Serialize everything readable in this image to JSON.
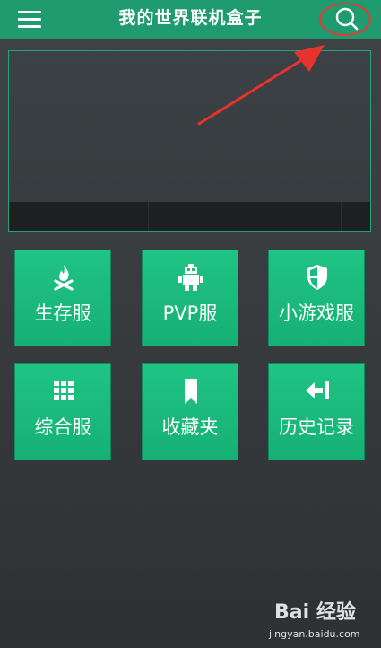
{
  "header": {
    "title": "我的世界联机盒子",
    "menu_icon": "hamburger-menu-icon",
    "search_icon": "search-icon",
    "highlight_color": "#e83a36",
    "bar_color": "#1f9b6f"
  },
  "tiles": [
    {
      "label": "生存服",
      "icon": "campfire-icon"
    },
    {
      "label": "PVP服",
      "icon": "robot-icon"
    },
    {
      "label": "小游戏服",
      "icon": "shield-icon"
    },
    {
      "label": "综合服",
      "icon": "grid-icon"
    },
    {
      "label": "收藏夹",
      "icon": "bookmark-icon"
    },
    {
      "label": "历史记录",
      "icon": "history-arrow-icon"
    }
  ],
  "watermark": {
    "brand": "Bai 经验",
    "url": "jingyan.baidu.com"
  },
  "accent_color": "#1fc484"
}
